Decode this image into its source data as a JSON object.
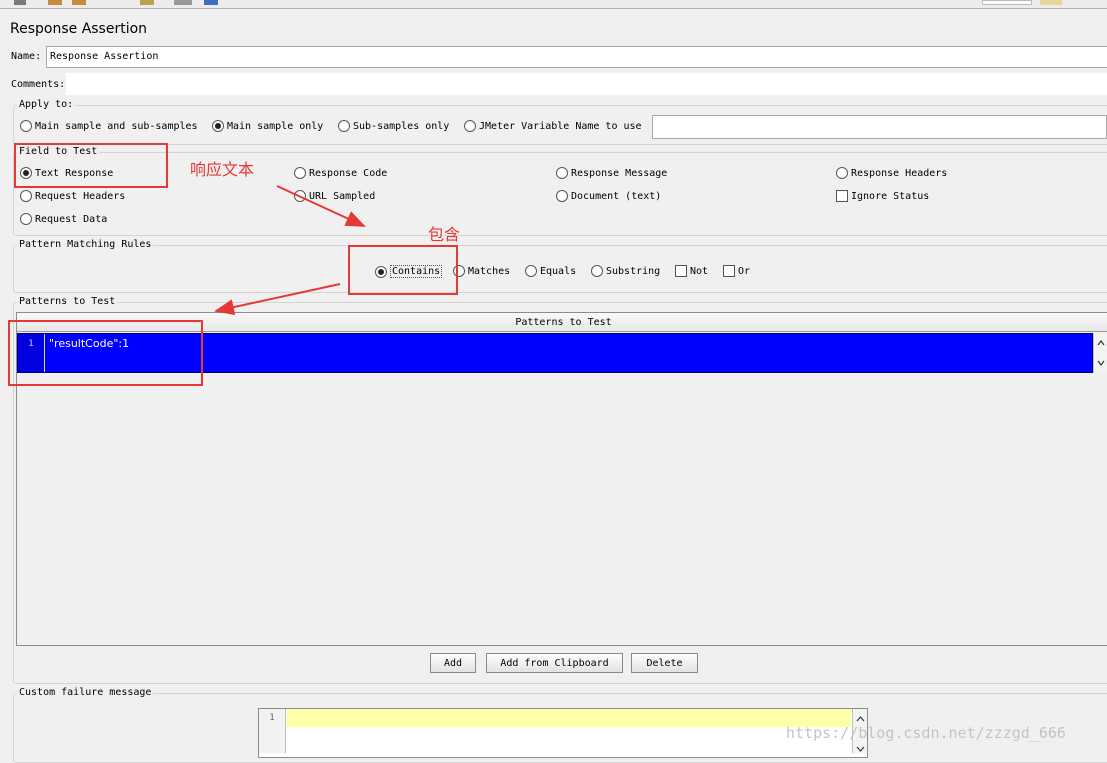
{
  "panel": {
    "title": "Response Assertion"
  },
  "name": {
    "label": "Name:",
    "value": "Response Assertion"
  },
  "comments": {
    "label": "Comments:",
    "value": ""
  },
  "apply_to": {
    "label": "Apply to:",
    "options": [
      "Main sample and sub-samples",
      "Main sample only",
      "Sub-samples only",
      "JMeter Variable Name to use"
    ],
    "selected": "Main sample only",
    "variable_value": ""
  },
  "field_to_test": {
    "label": "Field to Test",
    "options": [
      "Text Response",
      "Response Code",
      "Response Message",
      "Response Headers",
      "Request Headers",
      "URL Sampled",
      "Document (text)",
      "Request Data"
    ],
    "selected": "Text Response",
    "ignore_status": "Ignore Status"
  },
  "pattern_matching": {
    "label": "Pattern Matching Rules",
    "options": [
      "Contains",
      "Matches",
      "Equals",
      "Substring"
    ],
    "selected": "Contains",
    "not_label": "Not",
    "or_label": "Or"
  },
  "patterns": {
    "label": "Patterns to Test",
    "column": "Patterns to Test",
    "rows": [
      {
        "line": "1",
        "value": "\"resultCode\":1"
      }
    ]
  },
  "buttons": {
    "add": "Add",
    "add_clipboard": "Add from Clipboard",
    "delete": "Delete"
  },
  "failure": {
    "label": "Custom failure message",
    "line": "1",
    "value": ""
  },
  "annotations": {
    "text_response": "响应文本",
    "contains": "包含"
  },
  "watermark": "https://blog.csdn.net/zzzgd_666",
  "colors": {
    "selection": "#0000ff",
    "annotation": "#e53935",
    "editor_highlight": "#ffffa8"
  }
}
